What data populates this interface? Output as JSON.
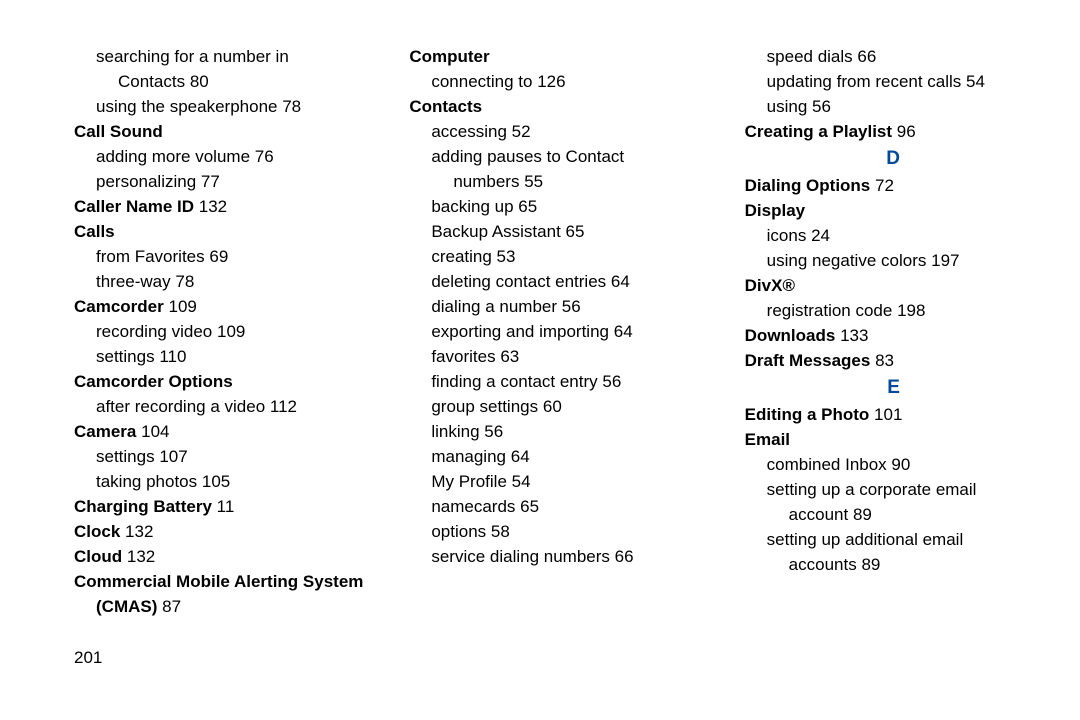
{
  "pageNumber": "201",
  "columns": [
    [
      {
        "type": "sub",
        "indent": 1,
        "text": "searching for a number in"
      },
      {
        "type": "sub",
        "indent": 2,
        "text": "Contacts",
        "page": "80"
      },
      {
        "type": "sub",
        "indent": 1,
        "text": "using the speakerphone",
        "page": "78"
      },
      {
        "type": "main",
        "text": "Call Sound"
      },
      {
        "type": "sub",
        "indent": 1,
        "text": "adding more volume",
        "page": "76"
      },
      {
        "type": "sub",
        "indent": 1,
        "text": "personalizing",
        "page": "77"
      },
      {
        "type": "main",
        "text": "Caller Name ID",
        "page": "132"
      },
      {
        "type": "main",
        "text": "Calls"
      },
      {
        "type": "sub",
        "indent": 1,
        "text": "from Favorites",
        "page": "69"
      },
      {
        "type": "sub",
        "indent": 1,
        "text": "three-way",
        "page": "78"
      },
      {
        "type": "main",
        "text": "Camcorder",
        "page": "109"
      },
      {
        "type": "sub",
        "indent": 1,
        "text": "recording video",
        "page": "109"
      },
      {
        "type": "sub",
        "indent": 1,
        "text": "settings",
        "page": "110"
      },
      {
        "type": "main",
        "text": "Camcorder Options"
      },
      {
        "type": "sub",
        "indent": 1,
        "text": "after recording a video",
        "page": "112"
      },
      {
        "type": "main",
        "text": "Camera",
        "page": "104"
      },
      {
        "type": "sub",
        "indent": 1,
        "text": "settings",
        "page": "107"
      },
      {
        "type": "sub",
        "indent": 1,
        "text": "taking photos",
        "page": "105"
      },
      {
        "type": "main",
        "text": "Charging Battery",
        "page": "11"
      },
      {
        "type": "main",
        "text": "Clock",
        "page": "132"
      },
      {
        "type": "main",
        "text": "Cloud",
        "page": "132"
      },
      {
        "type": "main",
        "text": "Commercial Mobile Alerting System"
      },
      {
        "type": "mainCont",
        "indent": 1,
        "text": "(CMAS)",
        "page": "87"
      }
    ],
    [
      {
        "type": "main",
        "text": "Computer"
      },
      {
        "type": "sub",
        "indent": 1,
        "text": "connecting to",
        "page": "126"
      },
      {
        "type": "main",
        "text": "Contacts"
      },
      {
        "type": "sub",
        "indent": 1,
        "text": "accessing",
        "page": "52"
      },
      {
        "type": "sub",
        "indent": 1,
        "text": "adding pauses to Contact"
      },
      {
        "type": "sub",
        "indent": 2,
        "text": "numbers",
        "page": "55"
      },
      {
        "type": "sub",
        "indent": 1,
        "text": "backing up",
        "page": "65"
      },
      {
        "type": "sub",
        "indent": 1,
        "text": "Backup Assistant",
        "page": "65"
      },
      {
        "type": "sub",
        "indent": 1,
        "text": "creating",
        "page": "53"
      },
      {
        "type": "sub",
        "indent": 1,
        "text": "deleting contact entries",
        "page": "64"
      },
      {
        "type": "sub",
        "indent": 1,
        "text": "dialing a number",
        "page": "56"
      },
      {
        "type": "sub",
        "indent": 1,
        "text": "exporting and importing",
        "page": "64"
      },
      {
        "type": "sub",
        "indent": 1,
        "text": "favorites",
        "page": "63"
      },
      {
        "type": "sub",
        "indent": 1,
        "text": "finding a contact entry",
        "page": "56"
      },
      {
        "type": "sub",
        "indent": 1,
        "text": "group settings",
        "page": "60"
      },
      {
        "type": "sub",
        "indent": 1,
        "text": "linking",
        "page": "56"
      },
      {
        "type": "sub",
        "indent": 1,
        "text": "managing",
        "page": "64"
      },
      {
        "type": "sub",
        "indent": 1,
        "text": "My Profile",
        "page": "54"
      },
      {
        "type": "sub",
        "indent": 1,
        "text": "namecards",
        "page": "65"
      },
      {
        "type": "sub",
        "indent": 1,
        "text": "options",
        "page": "58"
      },
      {
        "type": "sub",
        "indent": 1,
        "text": "service dialing numbers",
        "page": "66"
      }
    ],
    [
      {
        "type": "sub",
        "indent": 1,
        "text": "speed dials",
        "page": "66"
      },
      {
        "type": "sub",
        "indent": 1,
        "text": "updating from recent calls",
        "page": "54"
      },
      {
        "type": "sub",
        "indent": 1,
        "text": "using",
        "page": "56"
      },
      {
        "type": "main",
        "text": "Creating a Playlist",
        "page": "96"
      },
      {
        "type": "hdr",
        "text": "D"
      },
      {
        "type": "main",
        "text": "Dialing Options",
        "page": "72"
      },
      {
        "type": "main",
        "text": "Display"
      },
      {
        "type": "sub",
        "indent": 1,
        "text": "icons",
        "page": "24"
      },
      {
        "type": "sub",
        "indent": 1,
        "text": "using negative colors",
        "page": "197"
      },
      {
        "type": "main",
        "text": "DivX®"
      },
      {
        "type": "sub",
        "indent": 1,
        "text": "registration code",
        "page": "198"
      },
      {
        "type": "main",
        "text": "Downloads",
        "page": "133"
      },
      {
        "type": "main",
        "text": "Draft Messages",
        "page": "83"
      },
      {
        "type": "hdr",
        "text": "E"
      },
      {
        "type": "main",
        "text": "Editing a Photo",
        "page": "101"
      },
      {
        "type": "main",
        "text": "Email"
      },
      {
        "type": "sub",
        "indent": 1,
        "text": "combined Inbox",
        "page": "90"
      },
      {
        "type": "sub",
        "indent": 1,
        "text": "setting up a corporate email"
      },
      {
        "type": "sub",
        "indent": 2,
        "text": "account",
        "page": "89"
      },
      {
        "type": "sub",
        "indent": 1,
        "text": "setting up additional email"
      },
      {
        "type": "sub",
        "indent": 2,
        "text": "accounts",
        "page": "89"
      }
    ]
  ]
}
